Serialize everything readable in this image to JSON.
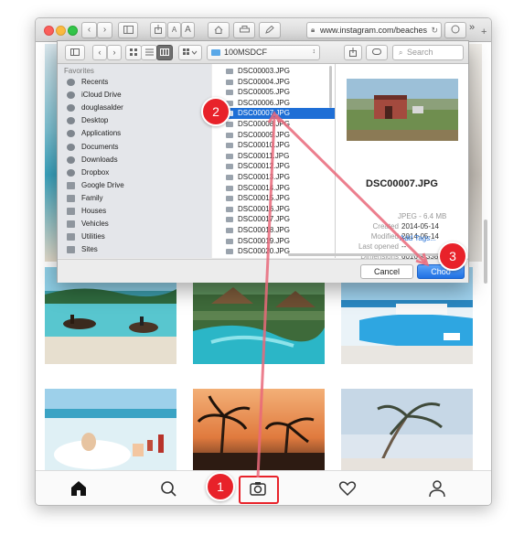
{
  "browser": {
    "url": "www.instagram.com/beaches",
    "nav_back": "‹",
    "nav_fwd": "›",
    "overflow": "»",
    "new_tab": "+"
  },
  "dialog": {
    "folder": "100MSDCF",
    "search_placeholder": "Search",
    "sidebar_heading": "Favorites",
    "sidebar_items": [
      {
        "label": "Recents",
        "icon": "clock-icon"
      },
      {
        "label": "iCloud Drive",
        "icon": "cloud-icon"
      },
      {
        "label": "douglasalder",
        "icon": "home-icon"
      },
      {
        "label": "Desktop",
        "icon": "desktop-icon"
      },
      {
        "label": "Applications",
        "icon": "applications-icon"
      },
      {
        "label": "Documents",
        "icon": "document-icon"
      },
      {
        "label": "Downloads",
        "icon": "download-icon"
      },
      {
        "label": "Dropbox",
        "icon": "dropbox-icon"
      },
      {
        "label": "Google Drive",
        "icon": "folder-icon"
      },
      {
        "label": "Family",
        "icon": "folder-icon"
      },
      {
        "label": "Houses",
        "icon": "folder-icon"
      },
      {
        "label": "Vehicles",
        "icon": "folder-icon"
      },
      {
        "label": "Utilities",
        "icon": "folder-icon"
      },
      {
        "label": "Sites",
        "icon": "folder-icon"
      }
    ],
    "files": [
      "DSC00003.JPG",
      "DSC00004.JPG",
      "DSC00005.JPG",
      "DSC00006.JPG",
      "DSC00007.JPG",
      "DSC00008.JPG",
      "DSC00009.JPG",
      "DSC00010.JPG",
      "DSC00011.JPG",
      "DSC00012.JPG",
      "DSC00013.JPG",
      "DSC00014.JPG",
      "DSC00015.JPG",
      "DSC00016.JPG",
      "DSC00017.JPG",
      "DSC00018.JPG",
      "DSC00019.JPG",
      "DSC00020.JPG"
    ],
    "selected_index": 4,
    "preview": {
      "filename": "DSC00007.JPG",
      "kind": "JPEG - 6.4 MB",
      "created_label": "Created",
      "created": "2014-05-14",
      "modified_label": "Modified",
      "modified": "2014-05-14",
      "last_opened_label": "Last opened",
      "last_opened": "--",
      "dimensions_label": "Dimensions",
      "dimensions": "6016 × 3384",
      "add_tags": "Add Tags..."
    },
    "cancel_label": "Cancel",
    "choose_label": "Choo"
  },
  "callouts": [
    "1",
    "2",
    "3"
  ],
  "colors": {
    "accent": "#1f6fd6",
    "callout": "#e8222a",
    "arrow": "#e9697a"
  }
}
